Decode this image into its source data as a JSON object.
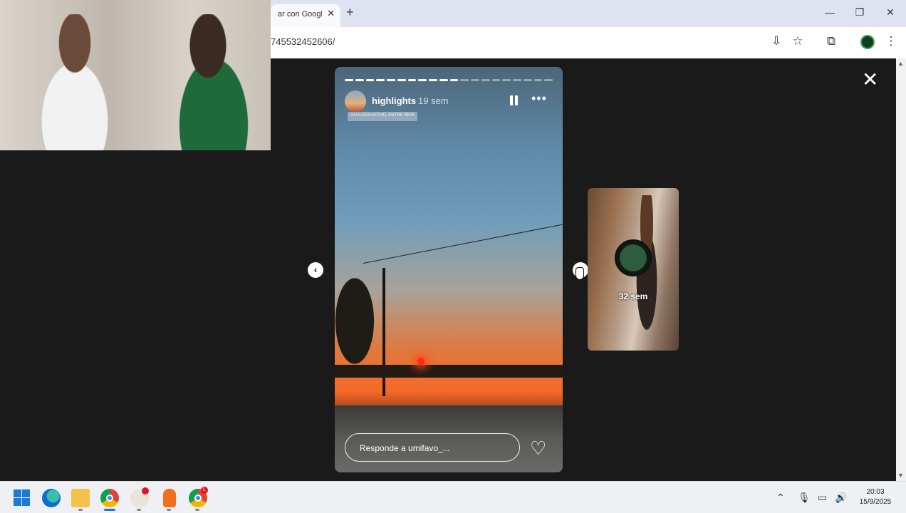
{
  "browser": {
    "tab_title": "ar con Google",
    "tab_close": "✕",
    "new_tab": "+",
    "url": "745532452606/",
    "window_controls": {
      "minimize": "—",
      "restore": "❐",
      "close": "✕"
    },
    "toolbar_icons": [
      "install-icon",
      "star-icon",
      "extensions-icon",
      "profile-avatar",
      "menu-icon"
    ]
  },
  "story": {
    "username": "highlights",
    "time_ago": "19 sem",
    "location_tag": "GUALEGUAYCHÚ, ENTRE RÍOS",
    "progress": {
      "total_segments": 20,
      "completed": 11
    },
    "reply_placeholder": "Responde a umifavo_...",
    "more": "•••"
  },
  "next_story": {
    "time_ago": "32 sem"
  },
  "nav": {
    "prev": "‹",
    "next": "›",
    "close": "✕"
  },
  "taskbar": {
    "apps": [
      "windows-start",
      "edge",
      "file-explorer",
      "chrome",
      "app",
      "app",
      "chrome-profile"
    ],
    "chrome2_badge": "L",
    "clock_time": "20:03",
    "clock_date": "15/9/2025"
  },
  "colors": {
    "viewer_bg": "#1a1a1a",
    "tab_bar": "#dde3f0",
    "accent": "#1a7ad9"
  }
}
